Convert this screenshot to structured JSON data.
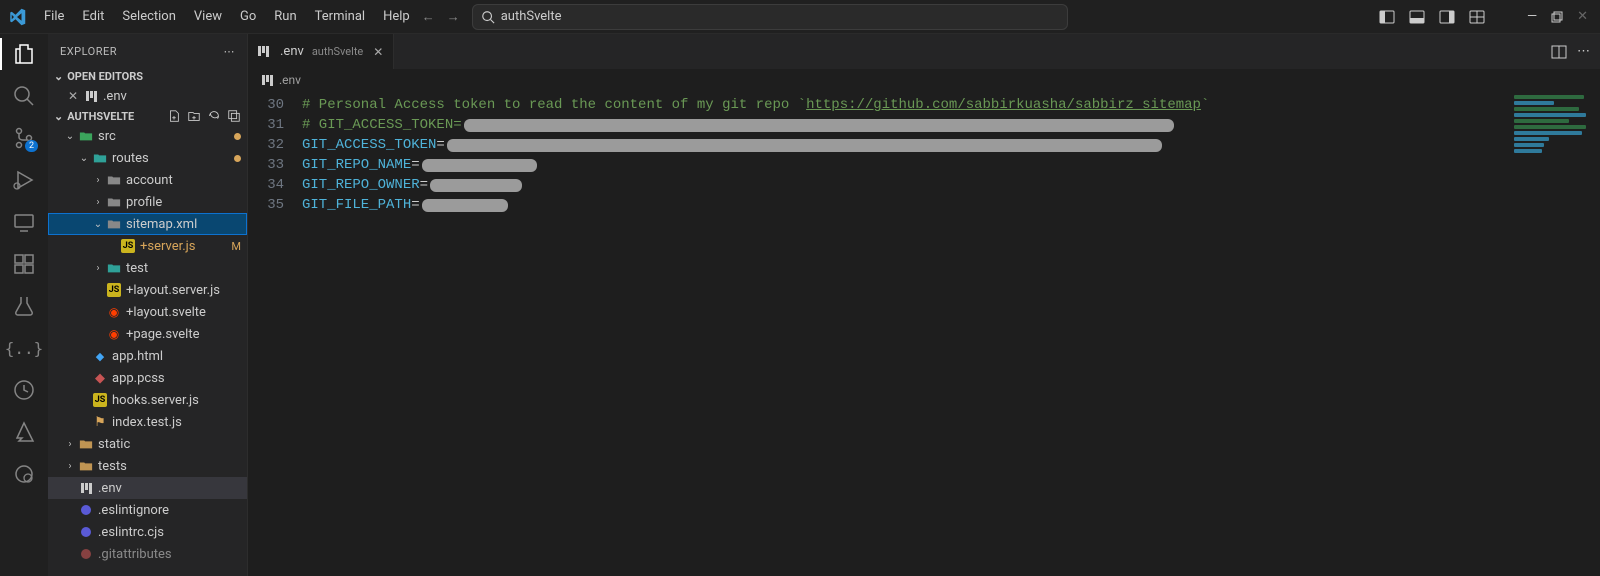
{
  "menu": [
    "File",
    "Edit",
    "Selection",
    "View",
    "Go",
    "Run",
    "Terminal",
    "Help"
  ],
  "search_text": "authSvelte",
  "sidebar": {
    "title": "EXPLORER",
    "sections": {
      "open_editors": {
        "label": "OPEN EDITORS",
        "items": [
          {
            "label": ".env"
          }
        ]
      },
      "project": {
        "label": "AUTHSVELTE"
      }
    }
  },
  "tree": {
    "src": "src",
    "routes": "routes",
    "account": "account",
    "profile": "profile",
    "sitemap": "sitemap.xml",
    "server_js": "+server.js",
    "server_js_mod": "M",
    "test": "test",
    "layout_server": "+layout.server.js",
    "layout_svelte": "+layout.svelte",
    "page_svelte": "+page.svelte",
    "app_html": "app.html",
    "app_pcss": "app.pcss",
    "hooks": "hooks.server.js",
    "index_test": "index.test.js",
    "static": "static",
    "tests": "tests",
    "env": ".env",
    "eslintignore": ".eslintignore",
    "eslintrc": ".eslintrc.cjs",
    "gitattributes": ".gitattributes"
  },
  "tab": {
    "label": ".env",
    "desc": "authSvelte"
  },
  "breadcrumb": {
    "file": ".env"
  },
  "source_badge": "2",
  "code": {
    "lines": [
      30,
      31,
      32,
      33,
      34,
      35
    ],
    "l30_comment_a": "# Personal Access token to read the content of my git repo `",
    "l30_url": "https://github.com/sabbirkuasha/sabbirz_sitemap",
    "l30_comment_b": "`",
    "l31_comment": "# GIT_ACCESS_TOKEN=",
    "l32_key": "GIT_ACCESS_TOKEN",
    "l33_key": "GIT_REPO_NAME",
    "l34_key": "GIT_REPO_OWNER",
    "l35_key": "GIT_FILE_PATH",
    "eq": "="
  }
}
